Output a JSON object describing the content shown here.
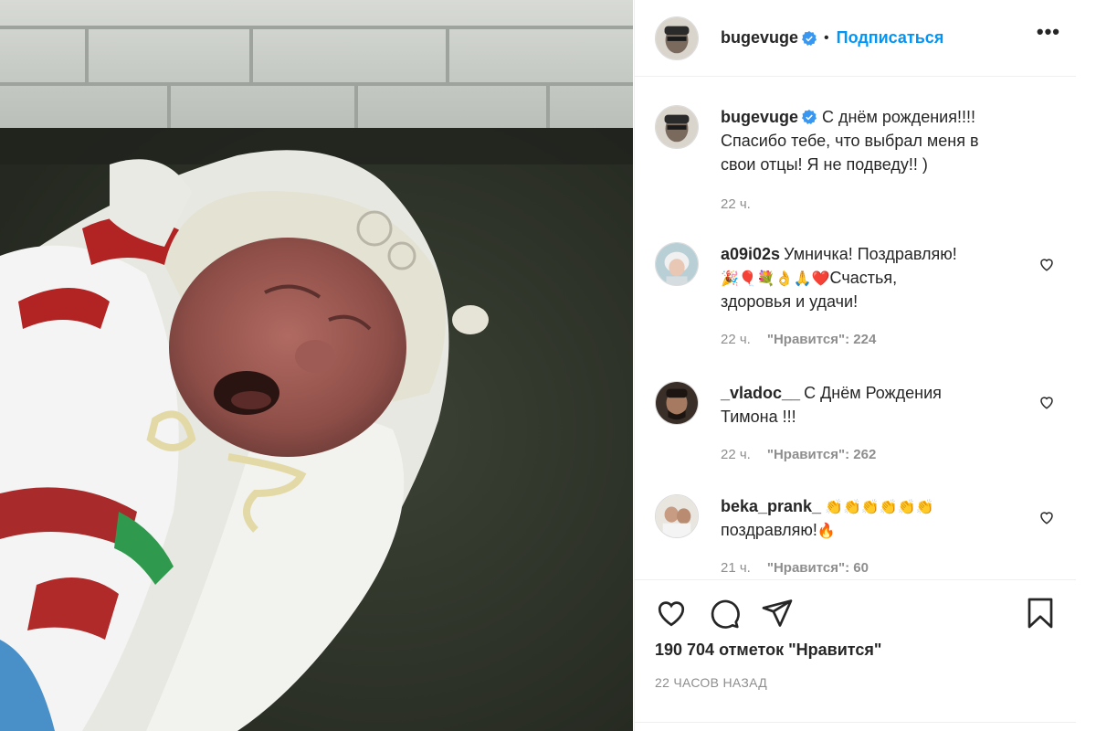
{
  "post": {
    "author": "bugevuge",
    "follow_label": "Подписаться",
    "dot": "•",
    "more_label": "•••",
    "caption_lines": [
      "С днём рождения!!!!",
      "Спасибо тебе, что выбрал меня в",
      "свои отцы! Я не подведу!! )"
    ],
    "caption_time": "22 ч."
  },
  "comments": [
    {
      "user": "a09i02s",
      "line1": "Умничка! Поздравляю!",
      "line2_emoji": "🎉🎈💐👌🙏❤️",
      "line2_text": "Счастья,",
      "line3": "здоровья и удачи!",
      "time": "22 ч.",
      "likes": "\"Нравится\": 224"
    },
    {
      "user": "_vladoc__",
      "line1": "С Днём Рождения",
      "line2": "Тимона !!!",
      "time": "22 ч.",
      "likes": "\"Нравится\": 262"
    },
    {
      "user": "beka_prank_",
      "line1_emoji": "👏👏👏👏👏👏",
      "line2_text": "поздравляю!",
      "line2_emoji": "🔥",
      "time": "21 ч.",
      "likes": "\"Нравится\": 60"
    }
  ],
  "footer": {
    "likes_count": "190 704 отметок \"Нравится\"",
    "posted_ago": "22 часов назад"
  },
  "icons": {
    "like": "heart-icon",
    "comment": "comment-icon",
    "share": "paper-plane-icon",
    "save": "bookmark-icon",
    "verified": "verified-badge-icon",
    "comment_like": "small-heart-icon"
  },
  "colors": {
    "accent": "#0095f6",
    "verified": "#3897f0",
    "heart_emoji": "#e0245e",
    "muted": "#8e8e8e",
    "text": "#262626"
  }
}
